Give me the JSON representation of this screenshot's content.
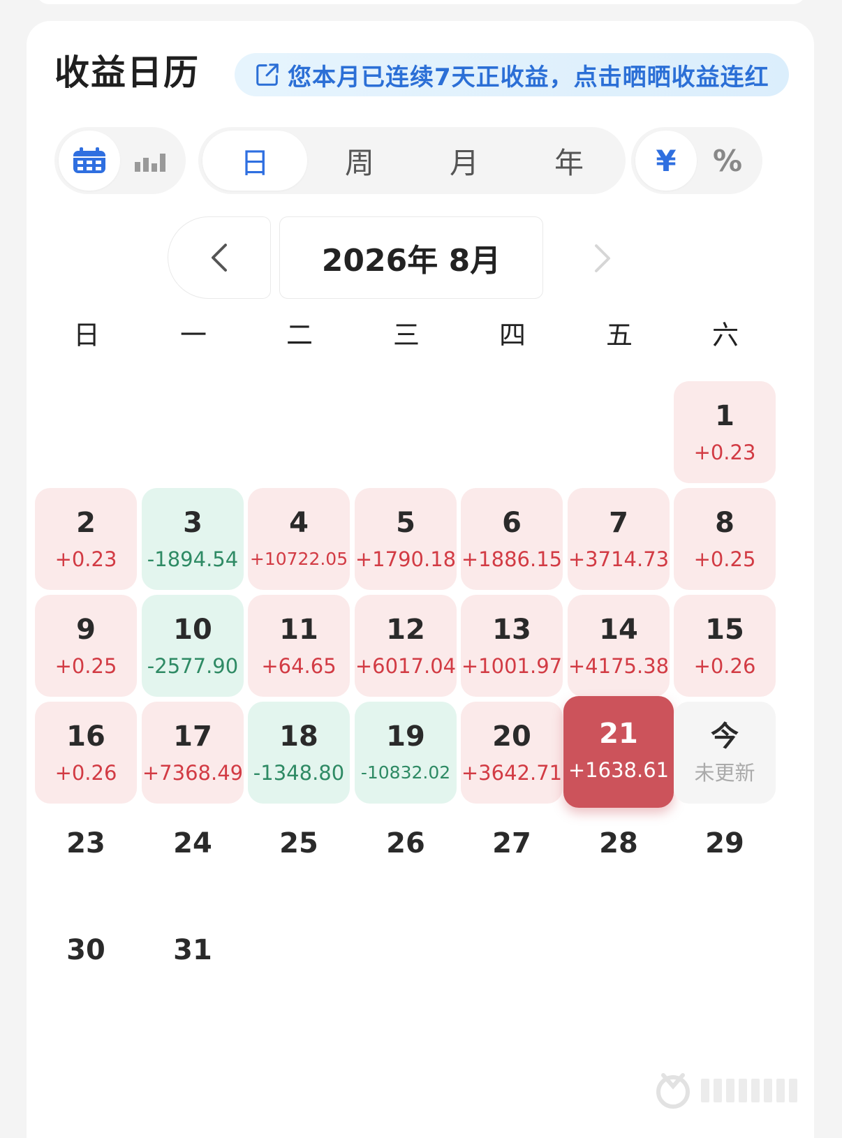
{
  "header": {
    "title": "收益日历",
    "banner_text": "您本月已连续7天正收益，点击晒晒收益连红"
  },
  "view_toggle": {
    "options": [
      {
        "icon": "calendar-icon",
        "active": true
      },
      {
        "icon": "bar-chart-icon",
        "active": false
      }
    ]
  },
  "period_tabs": {
    "options": [
      "日",
      "周",
      "月",
      "年"
    ],
    "active": "日"
  },
  "unit_toggle": {
    "options": [
      "¥",
      "%"
    ],
    "active": "¥"
  },
  "month_nav": {
    "label": "2026年 8月"
  },
  "weekdays": [
    "日",
    "一",
    "二",
    "三",
    "四",
    "五",
    "六"
  ],
  "days": [
    {
      "day": "1",
      "pnl": "+0.23",
      "status": "pos"
    },
    {
      "day": "2",
      "pnl": "+0.23",
      "status": "pos"
    },
    {
      "day": "3",
      "pnl": "-1894.54",
      "status": "neg"
    },
    {
      "day": "4",
      "pnl": "+10722.05",
      "status": "pos"
    },
    {
      "day": "5",
      "pnl": "+1790.18",
      "status": "pos"
    },
    {
      "day": "6",
      "pnl": "+1886.15",
      "status": "pos"
    },
    {
      "day": "7",
      "pnl": "+3714.73",
      "status": "pos"
    },
    {
      "day": "8",
      "pnl": "+0.25",
      "status": "pos"
    },
    {
      "day": "9",
      "pnl": "+0.25",
      "status": "pos"
    },
    {
      "day": "10",
      "pnl": "-2577.90",
      "status": "neg"
    },
    {
      "day": "11",
      "pnl": "+64.65",
      "status": "pos"
    },
    {
      "day": "12",
      "pnl": "+6017.04",
      "status": "pos"
    },
    {
      "day": "13",
      "pnl": "+1001.97",
      "status": "pos"
    },
    {
      "day": "14",
      "pnl": "+4175.38",
      "status": "pos"
    },
    {
      "day": "15",
      "pnl": "+0.26",
      "status": "pos"
    },
    {
      "day": "16",
      "pnl": "+0.26",
      "status": "pos"
    },
    {
      "day": "17",
      "pnl": "+7368.49",
      "status": "pos"
    },
    {
      "day": "18",
      "pnl": "-1348.80",
      "status": "neg"
    },
    {
      "day": "19",
      "pnl": "-10832.02",
      "status": "neg"
    },
    {
      "day": "20",
      "pnl": "+3642.71",
      "status": "pos"
    },
    {
      "day": "21",
      "pnl": "+1638.61",
      "status": "selected"
    },
    {
      "day": "今",
      "pnl": "未更新",
      "status": "today"
    },
    {
      "day": "23",
      "pnl": "",
      "status": "blank"
    },
    {
      "day": "24",
      "pnl": "",
      "status": "blank"
    },
    {
      "day": "25",
      "pnl": "",
      "status": "blank"
    },
    {
      "day": "26",
      "pnl": "",
      "status": "blank"
    },
    {
      "day": "27",
      "pnl": "",
      "status": "blank"
    },
    {
      "day": "28",
      "pnl": "",
      "status": "blank"
    },
    {
      "day": "29",
      "pnl": "",
      "status": "blank"
    },
    {
      "day": "30",
      "pnl": "",
      "status": "blank"
    },
    {
      "day": "31",
      "pnl": "",
      "status": "blank"
    }
  ],
  "first_weekday_index": 6,
  "colors": {
    "accent_blue": "#2f6fe0",
    "gain_red": "#d23b44",
    "loss_green": "#2e8a64",
    "gain_bg": "#fbeaea",
    "loss_bg": "#e3f5ee",
    "selected_bg": "#cc535b"
  }
}
